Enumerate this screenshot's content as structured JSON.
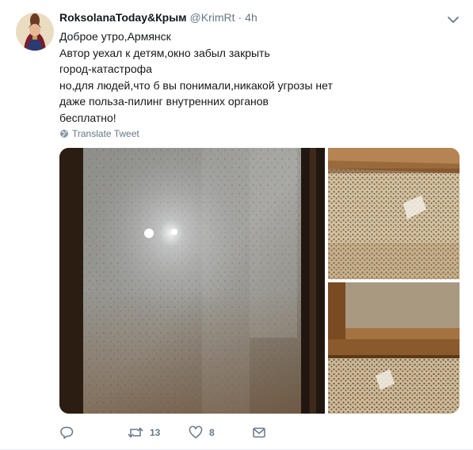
{
  "tweet": {
    "author": {
      "name": "RoksolanaToday&Крым",
      "handle": "@KrimRt",
      "separator": "·",
      "time": "4h"
    },
    "text_lines": [
      "Доброе утро,Армянск",
      "Автор уехал к детям,окно забыл закрыть",
      "город-катастрофа",
      "но,для людей,что б вы понимали,никакой угрозы нет",
      "даже польза-пилинг внутренних органов",
      "бесплатно!"
    ],
    "translate_label": "Translate Tweet",
    "actions": {
      "reply": {
        "icon": "reply-icon",
        "count": ""
      },
      "retweet": {
        "icon": "retweet-icon",
        "count": "13"
      },
      "like": {
        "icon": "heart-icon",
        "count": "8"
      },
      "message": {
        "icon": "envelope-icon",
        "count": ""
      }
    }
  },
  "colors": {
    "text": "#14171a",
    "secondary": "#657786",
    "border": "#e6ecf0"
  }
}
